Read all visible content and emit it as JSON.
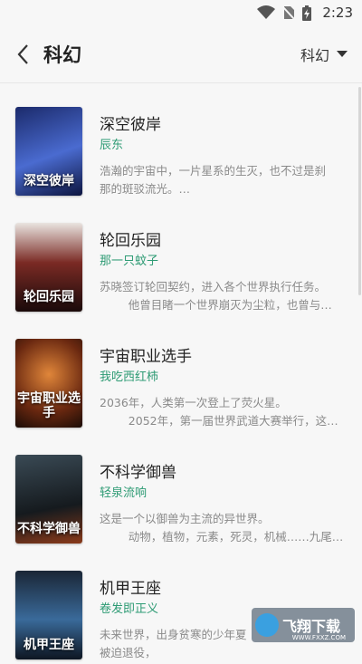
{
  "status_bar": {
    "time": "2:23"
  },
  "header": {
    "title": "科幻",
    "filter_label": "科幻"
  },
  "books": [
    {
      "title": "深空彼岸",
      "author": "辰东",
      "desc": "浩瀚的宇宙中，一片星系的生灭，也不过是刹\n那的斑驳流光。…",
      "cover_text": "深空彼岸",
      "cover_color": "#2b3c8c"
    },
    {
      "title": "轮回乐园",
      "author": "那一只蚊子",
      "desc": "苏晓签订轮回契约，进入各个世界执行任务。\n        他曾目睹一个世界崩灭为尘粒，也曾与…",
      "cover_text": "轮回乐园",
      "cover_color": "#5a1d1d"
    },
    {
      "title": "宇宙职业选手",
      "author": "我吃西红柿",
      "desc": "2036年，人类第一次登上了荧火星。\n        2052年，第一届世界武道大赛举行，这…",
      "cover_text": "宇宙职业选手",
      "cover_color": "#7a3a12"
    },
    {
      "title": "不科学御兽",
      "author": "轻泉流响",
      "desc": "这是一个以御兽为主流的异世界。\n        动物，植物，元素，死灵，机械……九尾…",
      "cover_text": "不科学御兽",
      "cover_color": "#2a2a2a"
    },
    {
      "title": "机甲王座",
      "author": "卷发即正义",
      "desc": "未来世界，出身贫寒的少年夏\n被迫退役，",
      "cover_text": "机甲王座",
      "cover_color": "#24384f"
    }
  ],
  "watermark": {
    "text": "飞翔下载",
    "sub": "WWW.FXXZ.COM"
  }
}
